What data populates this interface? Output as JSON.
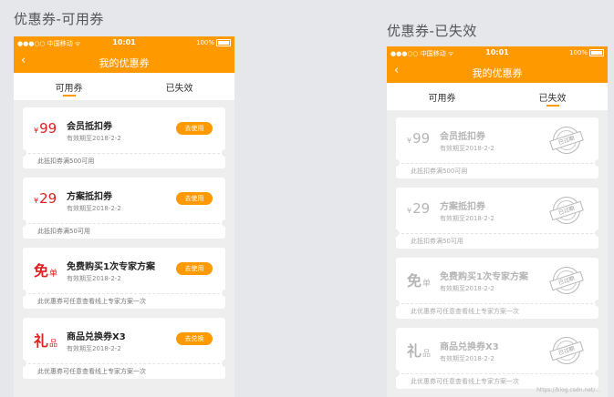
{
  "left": {
    "screen_title": "优惠券-可用券",
    "status": {
      "carrier": "●●●○○ 中国移动 ᯤ",
      "time": "10:01",
      "battery": "100%"
    },
    "nav": {
      "back_icon": "‹",
      "title": "我的优惠券"
    },
    "tabs": [
      {
        "label": "可用券",
        "active": true
      },
      {
        "label": "已失效",
        "active": false
      }
    ],
    "cards": [
      {
        "currency": "¥",
        "value": "99",
        "name": "会员抵扣券",
        "expiry": "有效期至2018-2-2",
        "desc": "此抵扣券满500可用",
        "button": "去使用"
      },
      {
        "currency": "¥",
        "value": "29",
        "name": "方案抵扣券",
        "expiry": "有效期至2018-2-2",
        "desc": "此抵扣券满50可用",
        "button": "去使用"
      },
      {
        "big": "免",
        "sub": "单",
        "name": "免费购买1次专家方案",
        "expiry": "有效期至2018-2-2",
        "desc": "此优惠券可任意查看线上专家方案一次",
        "button": "去使用"
      },
      {
        "big": "礼",
        "sub": "品",
        "name": "商品兑换券X3",
        "expiry": "有效期至2018-2-2",
        "desc": "此优惠券可任意查看线上专家方案一次",
        "button": "去兑换"
      }
    ]
  },
  "right": {
    "screen_title": "优惠券-已失效",
    "status": {
      "carrier": "●●●○○ 中国移动 ᯤ",
      "time": "10:01",
      "battery": "100%"
    },
    "nav": {
      "back_icon": "‹",
      "title": "我的优惠券"
    },
    "tabs": [
      {
        "label": "可用券",
        "active": false
      },
      {
        "label": "已失效",
        "active": true
      }
    ],
    "stamp": "已过期",
    "cards": [
      {
        "currency": "¥",
        "value": "99",
        "name": "会员抵扣券",
        "expiry": "有效期至2018-2-2",
        "desc": "此抵扣券满500可用"
      },
      {
        "currency": "¥",
        "value": "29",
        "name": "方案抵扣券",
        "expiry": "有效期至2018-2-2",
        "desc": "此抵扣券满50可用"
      },
      {
        "big": "免",
        "sub": "单",
        "name": "免费购买1次专家方案",
        "expiry": "有效期至2018-2-2",
        "desc": "此优惠券可任意查看线上专家方案一次"
      },
      {
        "big": "礼",
        "sub": "品",
        "name": "商品兑换券X3",
        "expiry": "有效期至2018-2-2",
        "desc": "此优惠券可任意查看线上专家方案一次"
      }
    ],
    "watermark": "https://blog.csdn.net/..."
  },
  "colors": {
    "accent": "#ff9900",
    "price": "#e02020",
    "expired": "#b5b5b5"
  }
}
